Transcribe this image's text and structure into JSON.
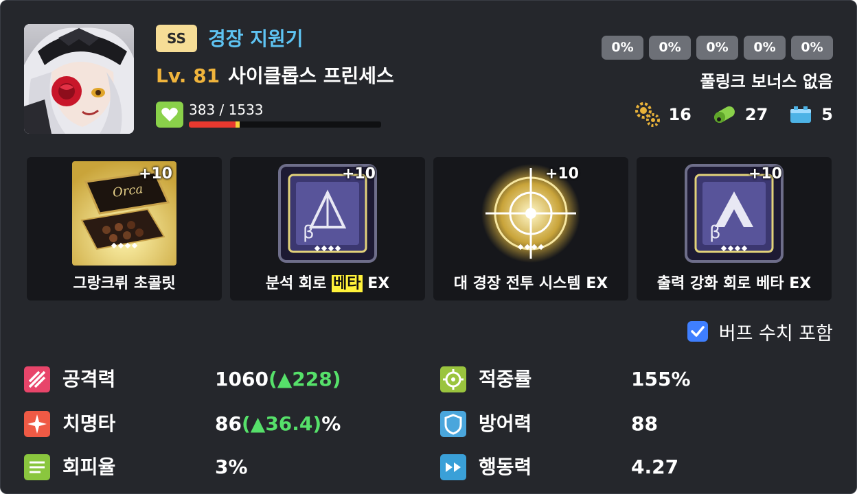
{
  "character": {
    "rank": "SS",
    "class_name": "경장 지원기",
    "level": "Lv. 81",
    "name": "사이클롭스 프린세스",
    "bond_text": "383 / 1533",
    "bond_progress": 0.25
  },
  "link_percentages": [
    "0%",
    "0%",
    "0%",
    "0%",
    "0%"
  ],
  "fulllink_bonus": "풀링크 보너스 없음",
  "resources": [
    {
      "icon": "gear-parts-icon",
      "value": "16"
    },
    {
      "icon": "nutrient-capsule-icon",
      "value": "27"
    },
    {
      "icon": "power-pack-icon",
      "value": "5"
    }
  ],
  "equipment": [
    {
      "icon": "chocolate-box-icon",
      "enhance": "+10",
      "label_pre": "그랑크뤼 초콜릿",
      "label_hl": "",
      "label_post": ""
    },
    {
      "icon": "chip-beta-icon",
      "enhance": "+10",
      "label_pre": "분석 회로 ",
      "label_hl": "베타",
      "label_post": " EX"
    },
    {
      "icon": "targeting-system-icon",
      "enhance": "+10",
      "label_pre": "대 경장 전투 시스템 EX",
      "label_hl": "",
      "label_post": ""
    },
    {
      "icon": "chip-beta-icon",
      "enhance": "+10",
      "label_pre": "출력 강화 회로 베타 EX",
      "label_hl": "",
      "label_post": ""
    }
  ],
  "buff_toggle": {
    "label": "버프 수치 포함",
    "checked": true
  },
  "stats": {
    "attack": {
      "name": "공격력",
      "base": "1060",
      "open": "(",
      "arrow": "▲",
      "bonus": "228",
      "close": ")",
      "suffix": ""
    },
    "crit": {
      "name": "치명타",
      "base": "86",
      "open": "(",
      "arrow": "▲",
      "bonus": "36.4",
      "close": ")",
      "suffix": "%"
    },
    "evasion": {
      "name": "회피율",
      "value": "3%"
    },
    "accuracy": {
      "name": "적중률",
      "value": "155%"
    },
    "defense": {
      "name": "방어력",
      "value": "88"
    },
    "speed": {
      "name": "행동력",
      "value": "4.27"
    }
  },
  "colors": {
    "background": "#25272c",
    "rank_badge": "#f6dd96",
    "class_name": "#5ec3f2",
    "level": "#f0b43c",
    "bonus_green": "#56e06a",
    "checkbox": "#3f7fff",
    "highlight": "#fff23a"
  }
}
